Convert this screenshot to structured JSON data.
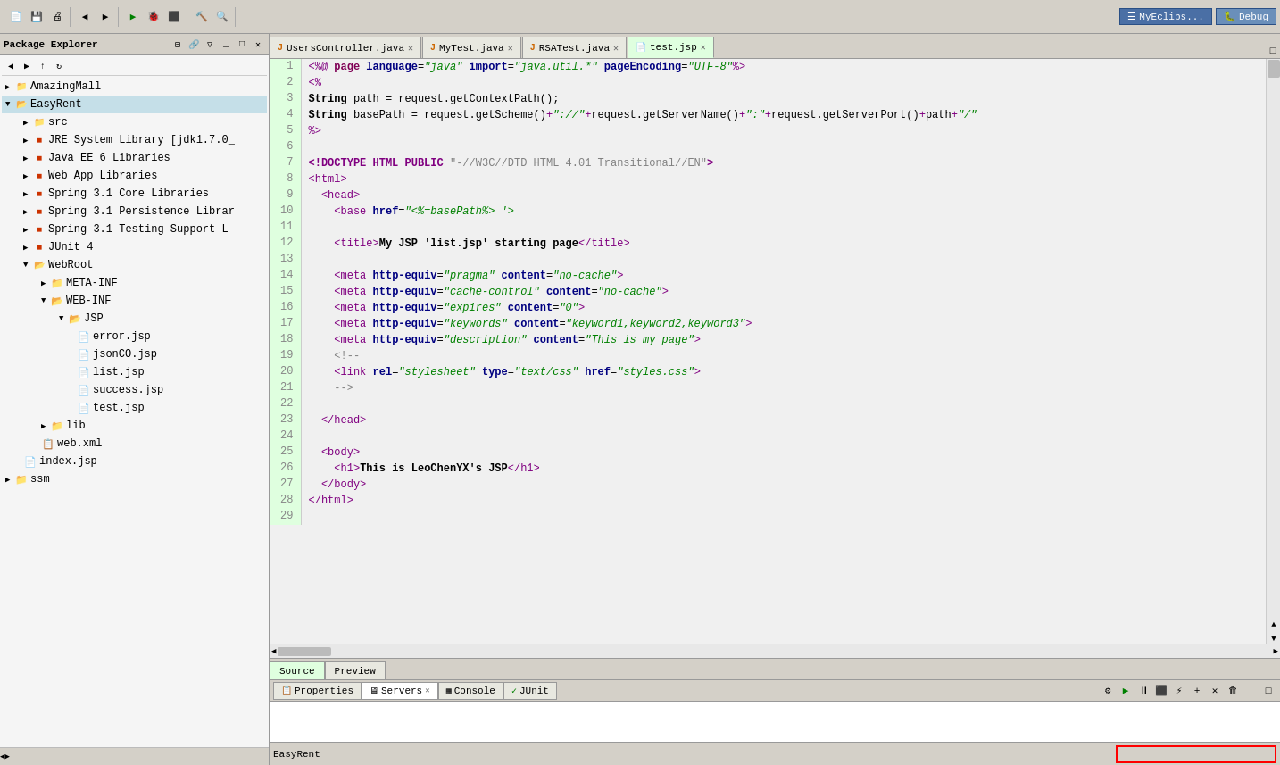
{
  "window": {
    "title": "MyEclips...",
    "perspective": "Debug"
  },
  "toolbar": {
    "groups": [
      "file",
      "edit",
      "run",
      "debug",
      "search",
      "perspective"
    ]
  },
  "packageExplorer": {
    "title": "Package Explorer",
    "projects": [
      {
        "name": "AmazingMall",
        "type": "project",
        "expanded": false
      },
      {
        "name": "EasyRent",
        "type": "project",
        "expanded": true,
        "selected": true,
        "children": [
          {
            "name": "src",
            "type": "folder",
            "indent": 1
          },
          {
            "name": "JRE System Library [jdk1.7.0_",
            "type": "library",
            "indent": 1
          },
          {
            "name": "Java EE 6 Libraries",
            "type": "library",
            "indent": 1
          },
          {
            "name": "Web App Libraries",
            "type": "library",
            "indent": 1
          },
          {
            "name": "Spring 3.1 Core Libraries",
            "type": "library",
            "indent": 1
          },
          {
            "name": "Spring 3.1 Persistence Librar",
            "type": "library",
            "indent": 1
          },
          {
            "name": "Spring 3.1 Testing Support L",
            "type": "library",
            "indent": 1
          },
          {
            "name": "JUnit 4",
            "type": "library",
            "indent": 1
          },
          {
            "name": "WebRoot",
            "type": "folder",
            "indent": 1,
            "expanded": true,
            "children": [
              {
                "name": "META-INF",
                "type": "folder",
                "indent": 2
              },
              {
                "name": "WEB-INF",
                "type": "folder",
                "indent": 2,
                "expanded": true,
                "children": [
                  {
                    "name": "JSP",
                    "type": "folder",
                    "indent": 3,
                    "expanded": true,
                    "children": [
                      {
                        "name": "error.jsp",
                        "type": "jsp",
                        "indent": 4
                      },
                      {
                        "name": "jsonCO.jsp",
                        "type": "jsp",
                        "indent": 4
                      },
                      {
                        "name": "list.jsp",
                        "type": "jsp",
                        "indent": 4
                      },
                      {
                        "name": "success.jsp",
                        "type": "jsp",
                        "indent": 4
                      },
                      {
                        "name": "test.jsp",
                        "type": "jsp",
                        "indent": 4
                      }
                    ]
                  }
                ]
              },
              {
                "name": "lib",
                "type": "folder",
                "indent": 2
              },
              {
                "name": "web.xml",
                "type": "xml",
                "indent": 2
              }
            ]
          },
          {
            "name": "index.jsp",
            "type": "jsp",
            "indent": 1
          }
        ]
      },
      {
        "name": "ssm",
        "type": "project",
        "expanded": false
      }
    ]
  },
  "editor": {
    "tabs": [
      {
        "name": "UsersController.java",
        "type": "java",
        "active": false
      },
      {
        "name": "MyTest.java",
        "type": "java",
        "active": false
      },
      {
        "name": "RSATest.java",
        "type": "java",
        "active": false
      },
      {
        "name": "test.jsp",
        "type": "jsp",
        "active": true
      }
    ],
    "bottomTabs": [
      {
        "name": "Source",
        "active": true
      },
      {
        "name": "Preview",
        "active": false
      }
    ],
    "lines": [
      {
        "num": 1,
        "code": "<%@ page language=\"java\" import=\"java.util.*\" pageEncoding=\"UTF-8\"%>"
      },
      {
        "num": 2,
        "code": "<%"
      },
      {
        "num": 3,
        "code": "String path = request.getContextPath();"
      },
      {
        "num": 4,
        "code": "String basePath = request.getScheme()+\"://\"+request.getServerName()+\":\"+request.getServerPort()+path+\"/\""
      },
      {
        "num": 5,
        "code": "%>"
      },
      {
        "num": 6,
        "code": ""
      },
      {
        "num": 7,
        "code": "<!DOCTYPE HTML PUBLIC \"-//W3C//DTD HTML 4.01 Transitional//EN\">"
      },
      {
        "num": 8,
        "code": "<html>"
      },
      {
        "num": 9,
        "code": "  <head>"
      },
      {
        "num": 10,
        "code": "    <base href=\"<%=basePath%> '>"
      },
      {
        "num": 11,
        "code": ""
      },
      {
        "num": 12,
        "code": "    <title>My JSP 'list.jsp' starting page</title>"
      },
      {
        "num": 13,
        "code": ""
      },
      {
        "num": 14,
        "code": "    <meta http-equiv=\"pragma\" content=\"no-cache\">"
      },
      {
        "num": 15,
        "code": "    <meta http-equiv=\"cache-control\" content=\"no-cache\">"
      },
      {
        "num": 16,
        "code": "    <meta http-equiv=\"expires\" content=\"0\">"
      },
      {
        "num": 17,
        "code": "    <meta http-equiv=\"keywords\" content=\"keyword1,keyword2,keyword3\">"
      },
      {
        "num": 18,
        "code": "    <meta http-equiv=\"description\" content=\"This is my page\">"
      },
      {
        "num": 19,
        "code": "    <!--"
      },
      {
        "num": 20,
        "code": "    <link rel=\"stylesheet\" type=\"text/css\" href=\"styles.css\">"
      },
      {
        "num": 21,
        "code": "    -->"
      },
      {
        "num": 22,
        "code": ""
      },
      {
        "num": 23,
        "code": "  </head>"
      },
      {
        "num": 24,
        "code": ""
      },
      {
        "num": 25,
        "code": "  <body>"
      },
      {
        "num": 26,
        "code": "    <h1>This is LeoChenYX's JSP</h1>"
      },
      {
        "num": 27,
        "code": "  </body>"
      },
      {
        "num": 28,
        "code": "</html>"
      },
      {
        "num": 29,
        "code": ""
      }
    ]
  },
  "bottomPanel": {
    "tabs": [
      {
        "name": "Properties",
        "icon": "properties",
        "active": false
      },
      {
        "name": "Servers",
        "icon": "servers",
        "active": true
      },
      {
        "name": "Console",
        "icon": "console",
        "active": false
      },
      {
        "name": "JUnit",
        "icon": "junit",
        "active": false
      }
    ]
  },
  "statusBar": {
    "projectName": "EasyRent"
  }
}
